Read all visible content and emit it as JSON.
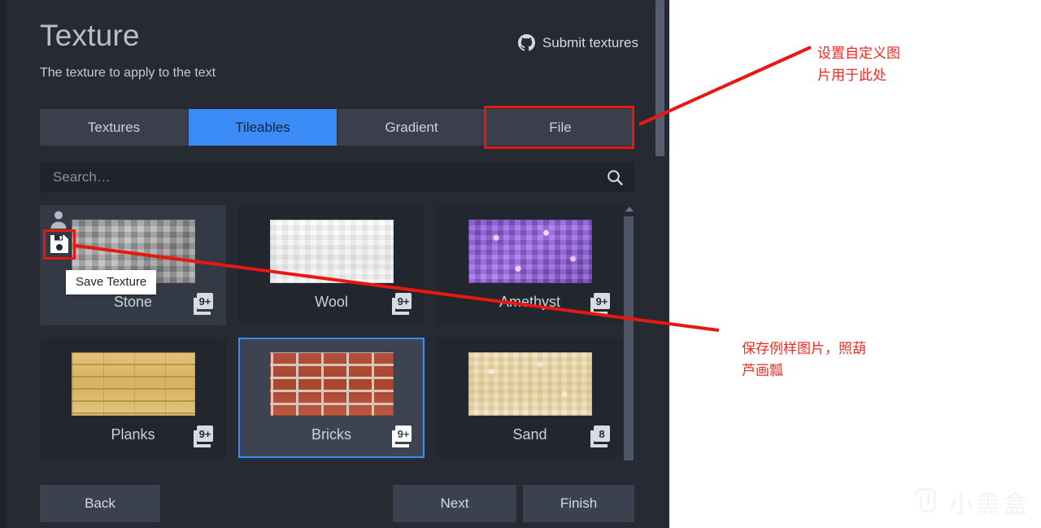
{
  "dialog": {
    "title": "Texture",
    "subtitle": "The texture to apply to the text",
    "submit_link": "Submit textures",
    "github_icon": "github-icon"
  },
  "tabs": [
    {
      "label": "Textures",
      "active": false
    },
    {
      "label": "Tileables",
      "active": true
    },
    {
      "label": "Gradient",
      "active": false
    },
    {
      "label": "File",
      "active": false,
      "highlighted": true
    }
  ],
  "search": {
    "placeholder": "Search…",
    "value": "",
    "icon": "search-icon"
  },
  "tooltip": {
    "text": "Save Texture"
  },
  "textures": [
    {
      "name": "Stone",
      "count": "9+",
      "owner_icon": "person-icon",
      "save_icon": "save-floppy-icon",
      "selected": false,
      "hovered": true
    },
    {
      "name": "Wool",
      "count": "9+",
      "selected": false,
      "hovered": false
    },
    {
      "name": "Amethyst",
      "count": "9+",
      "selected": false,
      "hovered": false
    },
    {
      "name": "Planks",
      "count": "9+",
      "selected": false,
      "hovered": false
    },
    {
      "name": "Bricks",
      "count": "9+",
      "selected": true,
      "hovered": false
    },
    {
      "name": "Sand",
      "count": "8",
      "selected": false,
      "hovered": false
    }
  ],
  "footer": {
    "back": "Back",
    "next": "Next",
    "finish": "Finish"
  },
  "annotations": [
    {
      "text": "设置自定义图\n片用于此处"
    },
    {
      "text": "保存例样图片，照葫\n芦画瓢"
    }
  ],
  "watermark": {
    "text": "小黑盒",
    "logo_icon": "heybox-logo-icon"
  },
  "colors": {
    "panel_bg": "#262a33",
    "tile_bg": "#22262e",
    "accent_blue": "#3b8cf7",
    "annotation_red": "#ed2b23",
    "highlight_red": "#e8170f",
    "tab_bg": "#3a3f4b",
    "button_bg": "#3b414e",
    "search_bg": "#1f232b"
  }
}
